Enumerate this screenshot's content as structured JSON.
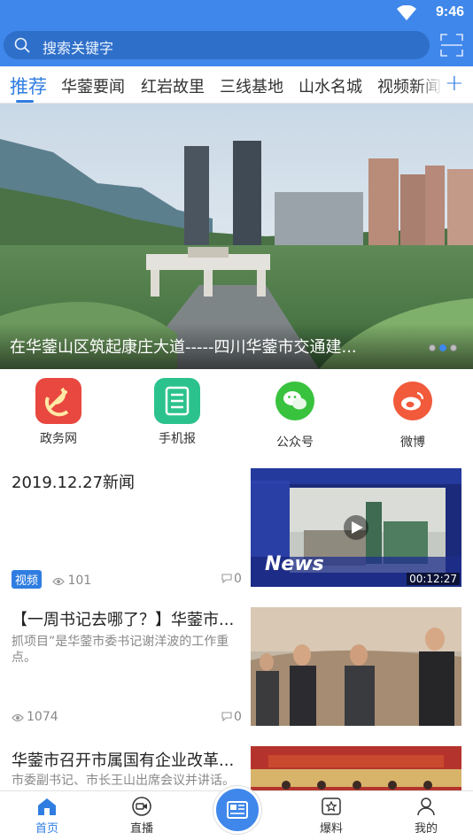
{
  "status_bar": {
    "time": "9:46"
  },
  "search": {
    "placeholder": "搜索关键字"
  },
  "tabs": [
    {
      "label": "推荐"
    },
    {
      "label": "华蓥要闻"
    },
    {
      "label": "红岩故里"
    },
    {
      "label": "三线基地"
    },
    {
      "label": "山水名城"
    },
    {
      "label": "视频新闻"
    }
  ],
  "banner": {
    "caption": "在华蓥山区筑起康庄大道-----四川华蓥市交通建...",
    "slide_count": 3,
    "active_slide": 2
  },
  "quick_entries": [
    {
      "label": "政务网",
      "icon": "party-emblem-icon",
      "color": "#e8483f"
    },
    {
      "label": "手机报",
      "icon": "newspaper-icon",
      "color": "#2cc28d"
    },
    {
      "label": "公众号",
      "icon": "wechat-icon",
      "color": "#39c23e"
    },
    {
      "label": "微博",
      "icon": "weibo-icon",
      "color": "#f15a3a"
    }
  ],
  "news": [
    {
      "title": "2019.12.27新闻",
      "summary": "",
      "tag": "视频",
      "views": "101",
      "comments": "0",
      "duration": "00:12:27",
      "thumb_overlay": "News"
    },
    {
      "title": "【一周书记去哪了？】华蓥市...",
      "summary": "抓项目”是华蓥市委书记谢洋波的工作重点。",
      "views": "1074",
      "comments": "0"
    },
    {
      "title": "华蓥市召开市属国有企业改革...",
      "summary": "市委副书记、市长王山出席会议并讲话。"
    }
  ],
  "bottom_nav": [
    {
      "label": "首页",
      "icon": "home-icon",
      "active": true
    },
    {
      "label": "直播",
      "icon": "live-camera-icon",
      "active": false
    },
    {
      "label": "",
      "icon": "news-center-icon",
      "active": false
    },
    {
      "label": "爆料",
      "icon": "report-star-icon",
      "active": false
    },
    {
      "label": "我的",
      "icon": "user-icon",
      "active": false
    }
  ],
  "colors": {
    "primary": "#3f87ea",
    "accent": "#2f7de1"
  }
}
